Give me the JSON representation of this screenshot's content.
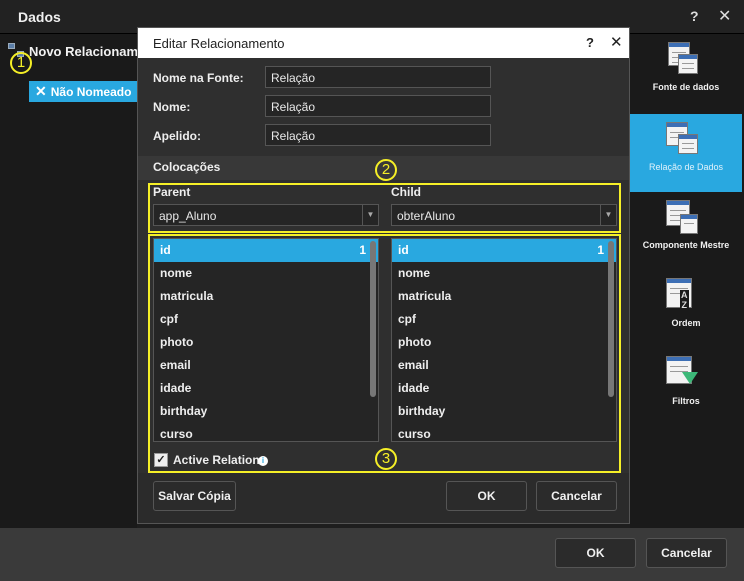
{
  "window": {
    "title": "Dados",
    "help": "?",
    "close": "✕"
  },
  "tree": {
    "root_label": "Novo Relacionamento",
    "node_label": "Não Nomeado"
  },
  "markers": [
    "1",
    "2",
    "3"
  ],
  "right_panel": [
    {
      "label": "Fonte de dados",
      "icon": "datasource-icon",
      "active": false
    },
    {
      "label": "Relação de Dados",
      "icon": "data-relation-icon",
      "active": true
    },
    {
      "label": "Componente Mestre",
      "icon": "master-component-icon",
      "active": false
    },
    {
      "label": "Ordem",
      "icon": "sort-icon",
      "active": false
    },
    {
      "label": "Filtros",
      "icon": "filter-icon",
      "active": false
    }
  ],
  "dialog": {
    "title": "Editar Relacionamento",
    "help": "?",
    "close": "✕",
    "fields": {
      "name_in_source": {
        "label": "Nome na Fonte:",
        "value": "Relação"
      },
      "name": {
        "label": "Nome:",
        "value": "Relação"
      },
      "alias": {
        "label": "Apelido:",
        "value": "Relação"
      }
    },
    "section_title": "Colocações",
    "parent": {
      "label": "Parent",
      "value": "app_Aluno"
    },
    "child": {
      "label": "Child",
      "value": "obterAluno"
    },
    "parent_columns": [
      "id",
      "nome",
      "matricula",
      "cpf",
      "photo",
      "email",
      "idade",
      "birthday",
      "curso"
    ],
    "child_columns": [
      "id",
      "nome",
      "matricula",
      "cpf",
      "photo",
      "email",
      "idade",
      "birthday",
      "curso"
    ],
    "selected_count": "1",
    "active_relation": {
      "label": "Active Relation",
      "checked": true,
      "check": "✓",
      "info": "i"
    },
    "buttons": {
      "save_copy": "Salvar Cópia",
      "ok": "OK",
      "cancel": "Cancelar"
    }
  },
  "footer": {
    "ok": "OK",
    "cancel": "Cancelar"
  },
  "colors": {
    "accent": "#29a8e0",
    "highlight": "#f5ef27",
    "background": "#1e1e1e",
    "dialog": "#2f2f2f"
  }
}
